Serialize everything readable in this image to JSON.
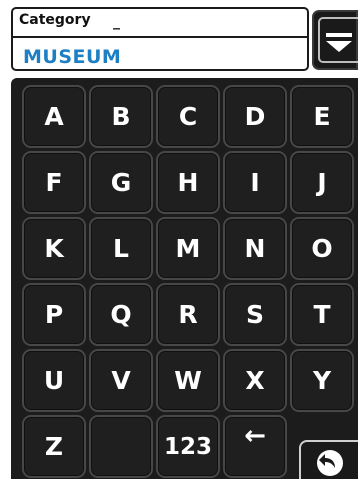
{
  "field": {
    "label": "Category",
    "cursor": "_",
    "value": "MUSEUM"
  },
  "keyboard": {
    "rows": [
      [
        "A",
        "B",
        "C",
        "D",
        "E"
      ],
      [
        "F",
        "G",
        "H",
        "I",
        "J"
      ],
      [
        "K",
        "L",
        "M",
        "N",
        "O"
      ],
      [
        "P",
        "Q",
        "R",
        "S",
        "T"
      ],
      [
        "U",
        "V",
        "W",
        "X",
        "Y"
      ]
    ],
    "last_row": {
      "z": "Z",
      "blank": "",
      "numbers": "123",
      "backspace": "←"
    }
  },
  "icons": {
    "dropdown": "dropdown-arrow-icon",
    "back": "back-arrow-icon"
  },
  "colors": {
    "value_text": "#1e7fc4",
    "keyboard_bg": "#1c1c1c"
  }
}
